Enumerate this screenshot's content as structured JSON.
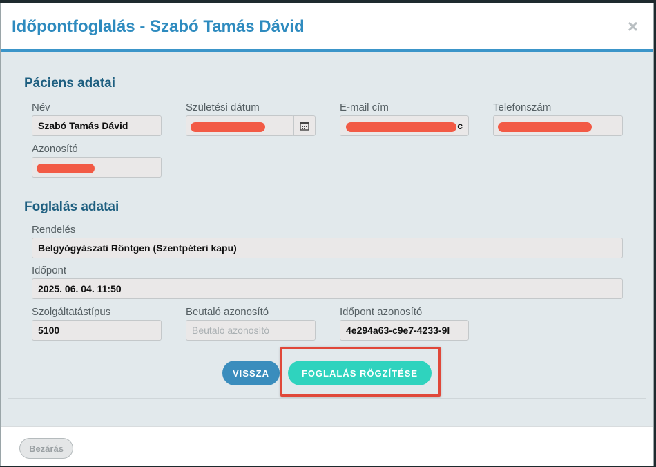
{
  "modal": {
    "title": "Időpontfoglalás - Szabó Tamás Dávid",
    "close_glyph": "×"
  },
  "patient": {
    "section_title": "Páciens adatai",
    "name_label": "Név",
    "name_value": "Szabó Tamás Dávid",
    "birth_label": "Születési dátum",
    "email_label": "E-mail cím",
    "email_visible_tail": "c",
    "phone_label": "Telefonszám",
    "id_label": "Azonosító"
  },
  "booking": {
    "section_title": "Foglalás adatai",
    "order_label": "Rendelés",
    "order_value": "Belgyógyászati Röntgen (Szentpéteri kapu)",
    "time_label": "Időpont",
    "time_value": "2025. 06. 04. 11:50",
    "service_label": "Szolgáltatástípus",
    "service_value": "5100",
    "referral_label": "Beutaló azonosító",
    "referral_placeholder": "Beutaló azonosító",
    "appt_id_label": "Időpont azonosító",
    "appt_id_value": "4e294a63-c9e7-4233-9l"
  },
  "actions": {
    "back_label": "VISSZA",
    "save_label": "FOGLALÁS RÖGZÍTÉSE"
  },
  "footer": {
    "close_label": "Bezárás"
  },
  "colors": {
    "accent": "#3b95c9",
    "save_button": "#2fd3be",
    "redaction": "#f25a45",
    "highlight": "#e0483a"
  },
  "icons": {
    "calendar": "calendar-icon",
    "close": "close-icon"
  }
}
